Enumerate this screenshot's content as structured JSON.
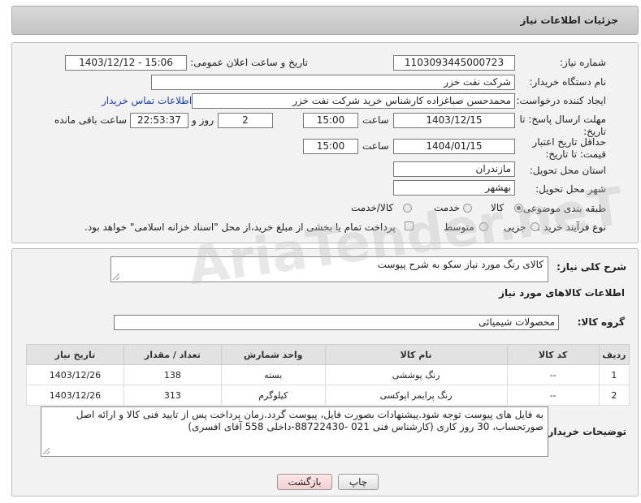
{
  "header": {
    "title": "جزئیات اطلاعات نیاز"
  },
  "fields": {
    "need_number_label": "شماره نیاز:",
    "need_number": "1103093445000723",
    "announce_label": "تاریخ و ساعت اعلان عمومی:",
    "announce_value": "1403/12/12 - 15:06",
    "buyer_org_label": "نام دستگاه خریدار:",
    "buyer_org": "شرکت نفت خزر",
    "creator_label": "ایجاد کننده درخواست:",
    "creator": "محمدحسن صباغزاده کارشناس خرید شرکت نفت خزر",
    "contact_link": "اطلاعات تماس خریدار",
    "reply_deadline_label": "مهلت ارسال پاسخ: تا تاریخ:",
    "reply_date": "1403/12/15",
    "time_label": "ساعت",
    "reply_time": "15:00",
    "days_value": "2",
    "days_label": "روز و",
    "remaining_time": "22:53:37",
    "remaining_label": "ساعت باقی مانده",
    "price_validity_label": "حداقل تاریخ اعتبار قیمت: تا تاریخ:",
    "price_date": "1404/01/15",
    "price_time": "15:00",
    "province_label": "استان محل تحویل:",
    "province": "مازندران",
    "city_label": "شهر محل تحویل:",
    "city": "بهشهر",
    "category_label": "طبقه بندی موضوعی:",
    "cat_goods": "کالا",
    "cat_service": "خدمت",
    "cat_goods_service": "کالا/خدمت",
    "process_label": "نوع فرآیند خرید :",
    "proc_minor": "جزیی",
    "proc_medium": "متوسط",
    "payment_note": "پرداخت تمام یا بخشی از مبلغ خرید،از محل \"اسناد خزانه اسلامی\" خواهد بود."
  },
  "description": {
    "label": "شرح کلی نیاز:",
    "text": "کالای رنگ مورد نیاز سکو به شرح پیوست"
  },
  "goods_info": {
    "title": "اطلاعات کالاهای مورد نیاز",
    "group_label": "گروه کالا:",
    "group_value": "محصولات شیمیائی"
  },
  "table": {
    "headers": [
      "ردیف",
      "کد کالا",
      "نام کالا",
      "واحد شمارش",
      "تعداد / مقدار",
      "تاریخ نیاز"
    ],
    "rows": [
      [
        "1",
        "--",
        "رنگ پوششی",
        "بسته",
        "138",
        "1403/12/26"
      ],
      [
        "2",
        "--",
        "رنگ پرایمر اپوکسی",
        "کیلوگرم",
        "313",
        "1403/12/26"
      ]
    ]
  },
  "buyer_notes": {
    "label": "توضیحات خریدار:",
    "text": "به فایل های پیوست توجه شود.پیشنهادات  بصورت فایل، پیوست گردد.زمان پرداخت پس از تایید فنی کالا و ارائه اصل صورتحساب، 30 روز کاری  (کارشناس فنی 021 -88722430-داخلی 558 آقای افسری)"
  },
  "buttons": {
    "print": "چاپ",
    "back": "بازگشت"
  },
  "watermark": "AriaTender.neT"
}
